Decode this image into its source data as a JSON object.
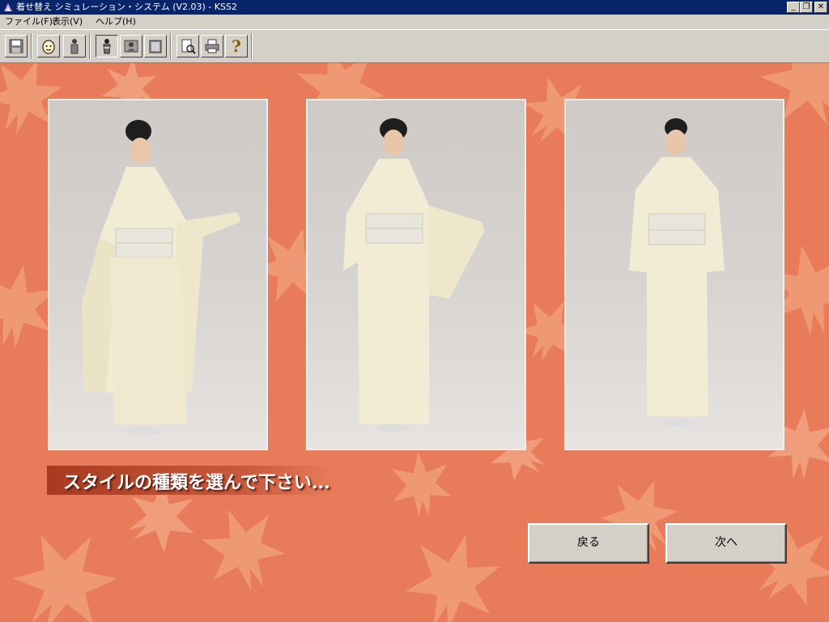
{
  "window": {
    "title": "着せ替え シミュレーション・システム (V2.03) - KSS2",
    "minimize_glyph": "_",
    "restore_glyph": "❐",
    "close_glyph": "✕"
  },
  "menu": [
    {
      "label": "ファイル(F)"
    },
    {
      "label": "表示(V)"
    },
    {
      "label": "ヘルプ(H)"
    }
  ],
  "toolbar": {
    "buttons": [
      {
        "icon": "save-icon"
      },
      {
        "icon": "face-icon"
      },
      {
        "icon": "person-icon"
      },
      {
        "icon": "kimono-figure-icon"
      },
      {
        "icon": "portrait-icon"
      },
      {
        "icon": "book-icon"
      },
      {
        "icon": "print-preview-icon"
      },
      {
        "icon": "printer-icon"
      },
      {
        "icon": "help-icon",
        "glyph": "?"
      }
    ]
  },
  "main": {
    "photos": [
      {
        "name": "style-photo-furisode",
        "style": "long sleeves, arm raised"
      },
      {
        "name": "style-photo-homongi",
        "style": "medium sleeves, arm raised"
      },
      {
        "name": "style-photo-tomesode",
        "style": "short sleeves, arms down"
      }
    ],
    "prompt": "スタイルの種類を選んで下さい...",
    "back_label": "戻る",
    "next_label": "次へ"
  },
  "colors": {
    "title_bar": "#08246b",
    "background": "#e87c5a",
    "leaf": "#f0a27e",
    "kimono": "#f2ecd4",
    "obi": "#e8e6dc"
  }
}
